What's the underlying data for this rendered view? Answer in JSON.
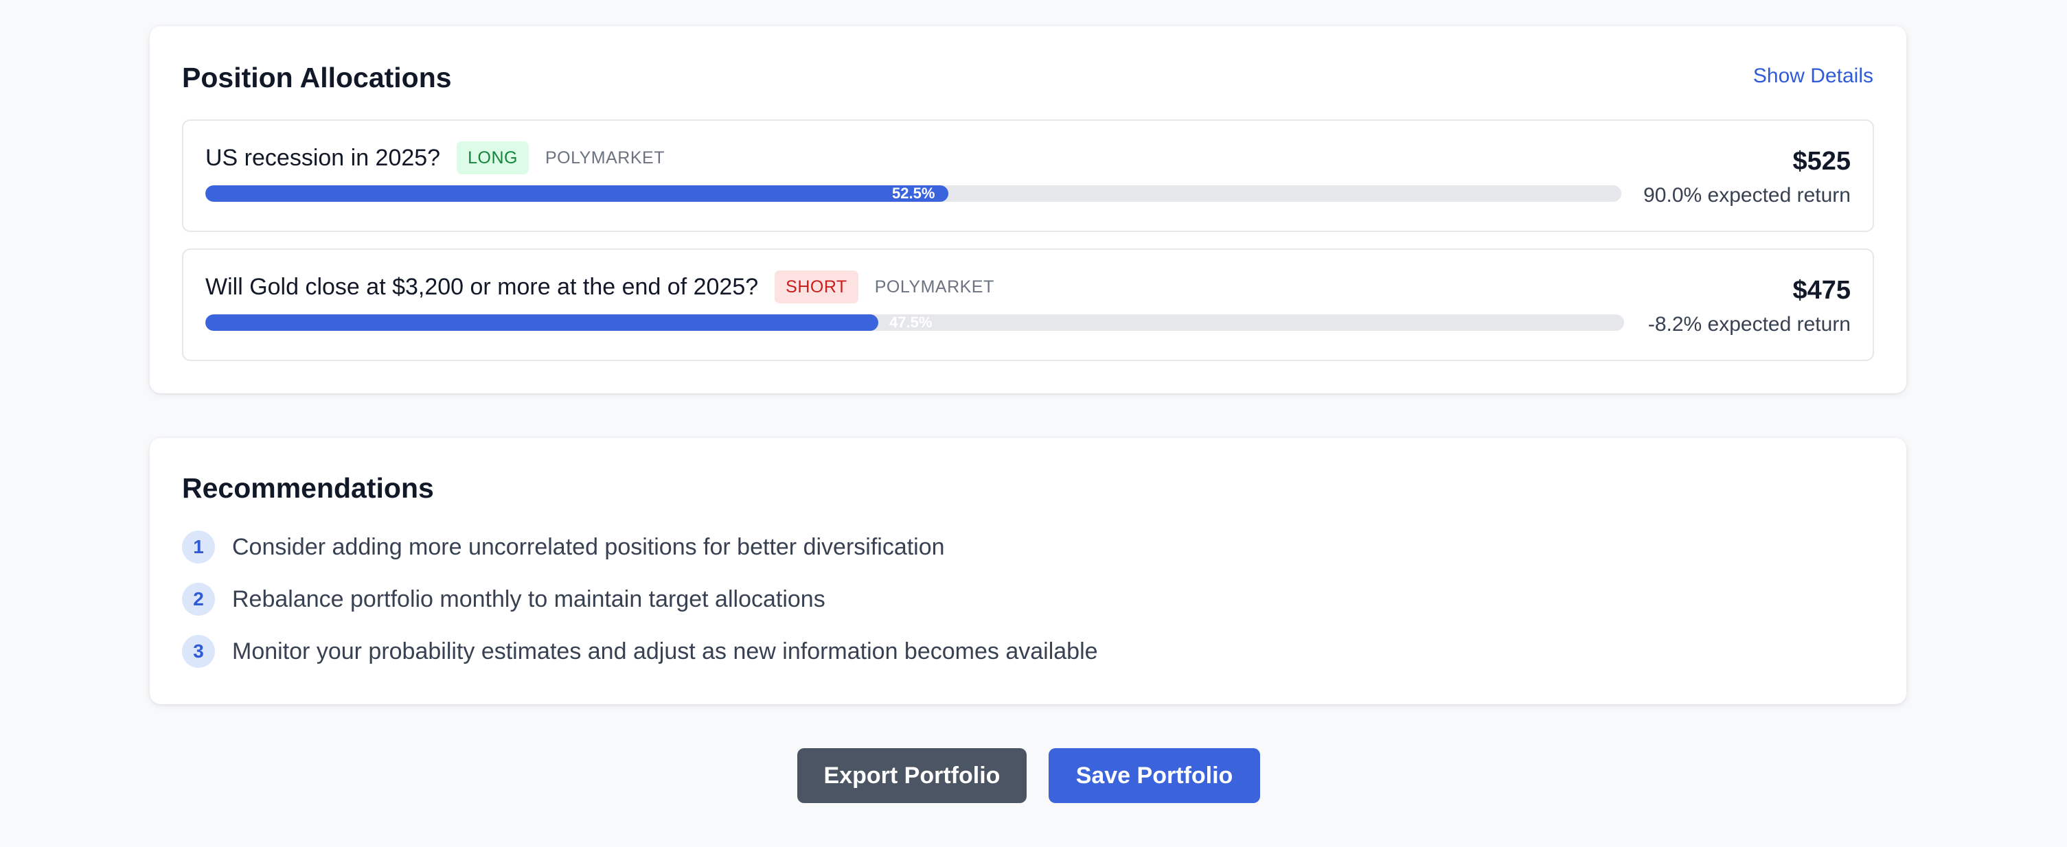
{
  "allocations": {
    "title": "Position Allocations",
    "show_details_label": "Show Details",
    "positions": [
      {
        "question": "US recession in 2025?",
        "direction": "LONG",
        "market": "POLYMARKET",
        "allocation_percent": 52.5,
        "allocation_label": "52.5%",
        "amount": "$525",
        "expected_return": "90.0% expected return"
      },
      {
        "question": "Will Gold close at $3,200 or more at the end of 2025?",
        "direction": "SHORT",
        "market": "POLYMARKET",
        "allocation_percent": 47.5,
        "allocation_label": "47.5%",
        "amount": "$475",
        "expected_return": "-8.2% expected return"
      }
    ]
  },
  "recommendations": {
    "title": "Recommendations",
    "items": [
      {
        "number": "1",
        "text": "Consider adding more uncorrelated positions for better diversification"
      },
      {
        "number": "2",
        "text": "Rebalance portfolio monthly to maintain target allocations"
      },
      {
        "number": "3",
        "text": "Monitor your probability estimates and adjust as new information becomes available"
      }
    ]
  },
  "actions": {
    "export_label": "Export Portfolio",
    "save_label": "Save Portfolio"
  },
  "colors": {
    "accent": "#3b63dc",
    "long_badge_bg": "#dcfce7",
    "long_badge_text": "#16853c",
    "short_badge_bg": "#fde2e2",
    "short_badge_text": "#c81e1e",
    "export_button": "#4b5563"
  }
}
